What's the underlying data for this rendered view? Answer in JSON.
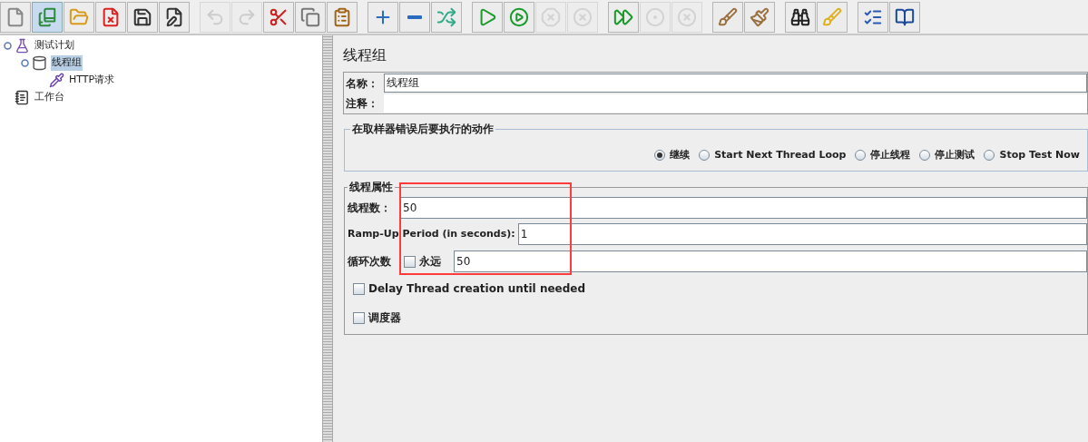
{
  "toolbar": [
    {
      "kind": "new",
      "disabled": false,
      "selected": false
    },
    {
      "kind": "templates",
      "disabled": false,
      "selected": true
    },
    {
      "kind": "open",
      "disabled": false,
      "selected": false
    },
    {
      "kind": "close",
      "disabled": false,
      "selected": false
    },
    {
      "kind": "save",
      "disabled": false,
      "selected": false
    },
    {
      "kind": "save-as",
      "disabled": false,
      "selected": false
    },
    {
      "kind": "sep"
    },
    {
      "kind": "undo",
      "disabled": true,
      "selected": false
    },
    {
      "kind": "redo",
      "disabled": true,
      "selected": false
    },
    {
      "kind": "cut",
      "disabled": false,
      "selected": false
    },
    {
      "kind": "copy",
      "disabled": false,
      "selected": false
    },
    {
      "kind": "paste",
      "disabled": false,
      "selected": false
    },
    {
      "kind": "sep"
    },
    {
      "kind": "expand",
      "disabled": false,
      "selected": false
    },
    {
      "kind": "collapse",
      "disabled": false,
      "selected": false
    },
    {
      "kind": "toggle",
      "disabled": false,
      "selected": false
    },
    {
      "kind": "sep"
    },
    {
      "kind": "start",
      "disabled": false,
      "selected": false
    },
    {
      "kind": "start-no-pause",
      "disabled": false,
      "selected": false
    },
    {
      "kind": "stop",
      "disabled": true,
      "selected": false
    },
    {
      "kind": "shutdown",
      "disabled": true,
      "selected": false
    },
    {
      "kind": "sep"
    },
    {
      "kind": "remote-start",
      "disabled": false,
      "selected": false
    },
    {
      "kind": "remote-stop",
      "disabled": true,
      "selected": false
    },
    {
      "kind": "remote-shutdown",
      "disabled": true,
      "selected": false
    },
    {
      "kind": "sep"
    },
    {
      "kind": "clear",
      "disabled": false,
      "selected": false
    },
    {
      "kind": "clear-all",
      "disabled": false,
      "selected": false
    },
    {
      "kind": "sep"
    },
    {
      "kind": "search",
      "disabled": false,
      "selected": false
    },
    {
      "kind": "reset-search",
      "disabled": false,
      "selected": false
    },
    {
      "kind": "sep"
    },
    {
      "kind": "function-helper",
      "disabled": false,
      "selected": false
    },
    {
      "kind": "help",
      "disabled": false,
      "selected": false
    }
  ],
  "tree": [
    {
      "label": "测试计划",
      "kind": "plan",
      "selected": false,
      "children": [
        {
          "label": "线程组",
          "kind": "thread-group",
          "selected": true,
          "children": [
            {
              "label": "HTTP请求",
              "kind": "sampler",
              "selected": false
            }
          ]
        }
      ]
    },
    {
      "label": "工作台",
      "kind": "workbench",
      "selected": false
    }
  ],
  "panel": {
    "title": "线程组",
    "name": {
      "label": "名称：",
      "value": "线程组"
    },
    "comment": {
      "label": "注释："
    },
    "error_action": {
      "legend": "在取样器错误后要执行的动作",
      "options": [
        {
          "label": "继续",
          "selected": true
        },
        {
          "label": "Start Next Thread Loop",
          "selected": false
        },
        {
          "label": "停止线程",
          "selected": false
        },
        {
          "label": "停止测试",
          "selected": false
        },
        {
          "label": "Stop Test Now",
          "selected": false
        }
      ]
    },
    "thread_properties": {
      "legend": "线程属性",
      "threads": {
        "label": "线程数：",
        "value": "50"
      },
      "ramp_up": {
        "label": "Ramp-Up Period (in seconds):",
        "value": "1"
      },
      "loop": {
        "label": "循环次数",
        "forever": {
          "label": "永远",
          "checked": false
        },
        "value": "50"
      },
      "delay": {
        "label": "Delay Thread creation until needed",
        "checked": false
      },
      "scheduler": {
        "label": "调度器",
        "checked": false
      }
    }
  }
}
